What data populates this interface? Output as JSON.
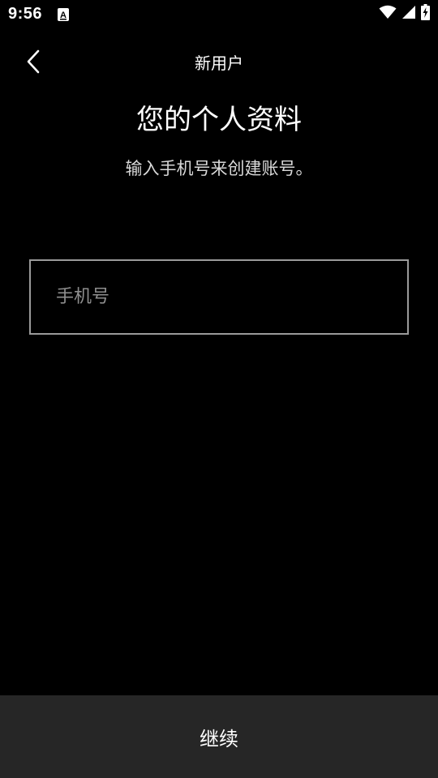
{
  "status_bar": {
    "time": "9:56",
    "icons": [
      "notification-a-icon",
      "wifi-icon",
      "signal-icon",
      "battery-charging-icon"
    ]
  },
  "header": {
    "back_icon": "chevron-left-icon",
    "title": "新用户"
  },
  "main": {
    "title": "您的个人资料",
    "subtitle": "输入手机号来创建账号。",
    "phone_input": {
      "value": "",
      "placeholder": "手机号"
    }
  },
  "footer": {
    "continue_label": "继续"
  },
  "colors": {
    "background": "#000000",
    "text": "#ffffff",
    "subtitle": "#d8d8d8",
    "input_border": "#9a9a9a",
    "placeholder": "#8e8e8e",
    "button_background": "#262626"
  }
}
